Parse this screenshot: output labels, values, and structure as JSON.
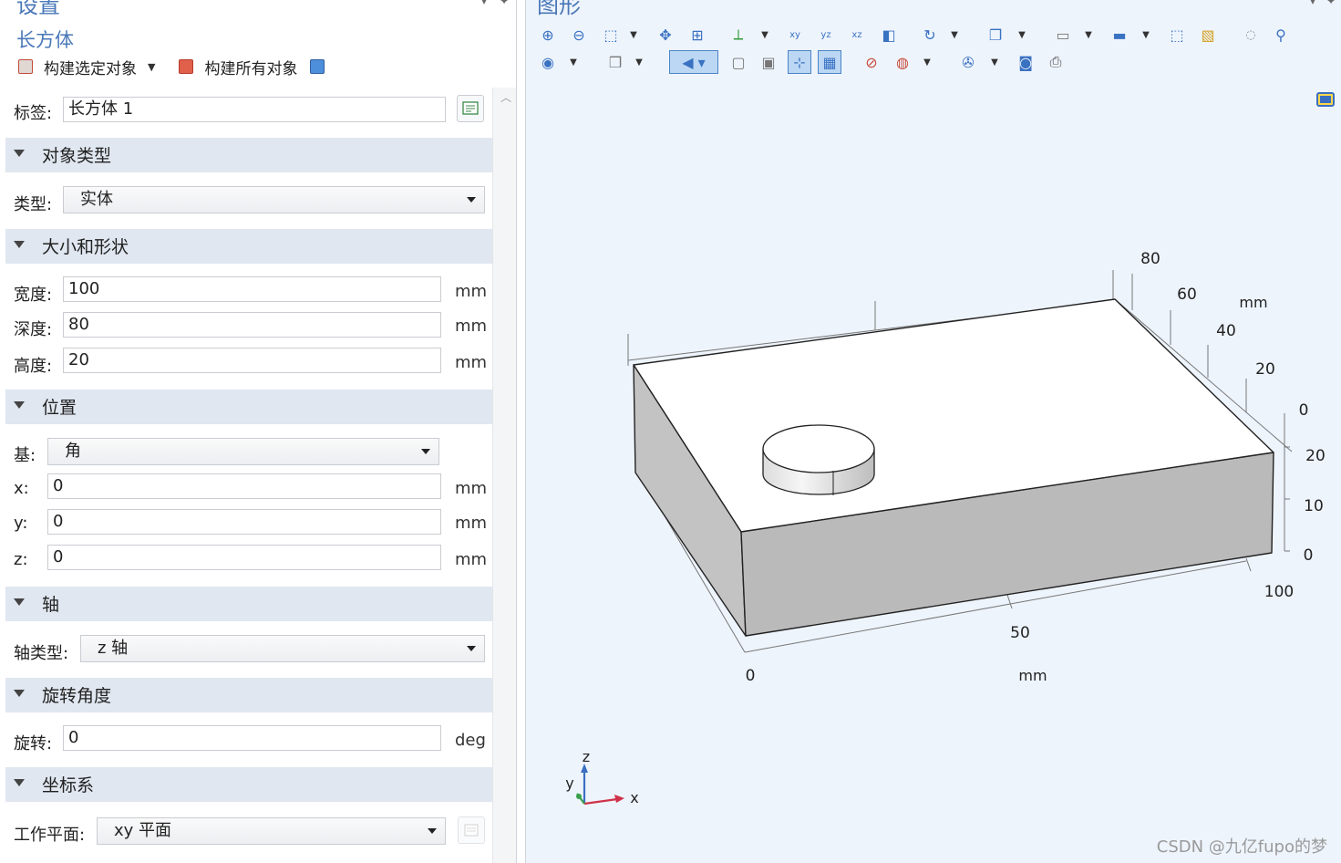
{
  "settings": {
    "title": "设置",
    "subtitle": "长方体",
    "build_selected": "构建选定对象",
    "build_all": "构建所有对象",
    "label_label": "标签:",
    "label_value": "长方体 1",
    "sections": {
      "object_type": "对象类型",
      "size_shape": "大小和形状",
      "position": "位置",
      "axis": "轴",
      "rotation": "旋转角度",
      "coord": "坐标系"
    },
    "type_label": "类型:",
    "type_value": "实体",
    "width_label": "宽度:",
    "width_value": "100",
    "depth_label": "深度:",
    "depth_value": "80",
    "height_label": "高度:",
    "height_value": "20",
    "unit_mm": "mm",
    "unit_deg": "deg",
    "base_label": "基:",
    "base_value": "角",
    "x_label": "x:",
    "x_value": "0",
    "y_label": "y:",
    "y_value": "0",
    "z_label": "z:",
    "z_value": "0",
    "axis_type_label": "轴类型:",
    "axis_type_value": "z 轴",
    "rotation_label": "旋转:",
    "rotation_value": "0",
    "workplane_label": "工作平面:",
    "workplane_value": "xy 平面"
  },
  "graphics": {
    "title": "图形",
    "x_ticks": [
      "0",
      "50",
      "100"
    ],
    "x_unit": "mm",
    "y_ticks": [
      "0",
      "20",
      "40",
      "60",
      "80"
    ],
    "y_unit": "mm",
    "z_ticks": [
      "0",
      "10",
      "20"
    ],
    "triad": {
      "x": "x",
      "y": "y",
      "z": "z"
    }
  },
  "watermark": "CSDN @九亿fupo的梦",
  "colors": {
    "accent": "#4a78b8",
    "section_bg": "#e0e7f0",
    "graphics_bg": "#eef4fc",
    "box_front": "#bababa",
    "box_side": "#c3c3c3",
    "box_top": "#ffffff"
  },
  "icons": {
    "graphics_toolbar": [
      "zoom-in-icon",
      "zoom-out-icon",
      "zoom-box-icon",
      "pan-icon",
      "zoom-extents-icon",
      "axes-icon",
      "xy-view-icon",
      "yz-view-icon",
      "xz-view-icon",
      "section-icon",
      "rotate-icon",
      "transparency-icon",
      "render-icon",
      "scene-light-icon",
      "select-box-icon",
      "select-all-icon",
      "hide-icon",
      "find-icon",
      "view-icon",
      "cube-views-icon",
      "wireframe-icon",
      "grid-icon",
      "camera-icon",
      "print-icon"
    ]
  }
}
